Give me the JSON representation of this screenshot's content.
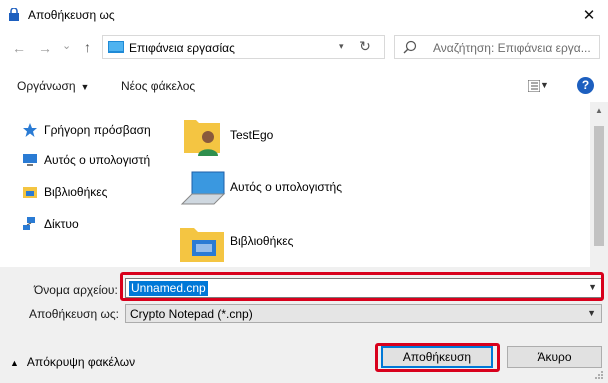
{
  "window": {
    "title": "Αποθήκευση ως",
    "close_glyph": "✕"
  },
  "nav": {
    "back_glyph": "←",
    "forward_glyph": "→",
    "recent_glyph": "⌄",
    "up_glyph": "↑",
    "address_path": "Επιφάνεια εργασίας",
    "refresh_glyph": "↻",
    "search_placeholder": "Αναζήτηση: Επιφάνεια εργα..."
  },
  "toolbar": {
    "organize_label": "Οργάνωση",
    "new_folder_label": "Νέος φάκελος",
    "help_glyph": "?"
  },
  "sidebar": {
    "items": [
      {
        "label": "Γρήγορη πρόσβαση",
        "icon": "star-icon"
      },
      {
        "label": "Αυτός ο υπολογιστή",
        "icon": "computer-icon"
      },
      {
        "label": "Βιβλιοθήκες",
        "icon": "library-icon"
      },
      {
        "label": "Δίκτυο",
        "icon": "network-icon"
      }
    ]
  },
  "content": {
    "items": [
      {
        "label": "TestEgo",
        "icon": "user-folder-icon"
      },
      {
        "label": "Αυτός ο υπολογιστής",
        "icon": "computer-icon"
      },
      {
        "label": "Βιβλιοθήκες",
        "icon": "library-folder-icon"
      }
    ]
  },
  "form": {
    "filename_label": "Όνομα αρχείου:",
    "filename_value": "Unnamed.cnp",
    "filetype_label": "Αποθήκευση ως:",
    "filetype_value": "Crypto Notepad (*.cnp)"
  },
  "footer": {
    "hide_folders_label": "Απόκρυψη φακέλων",
    "save_label": "Αποθήκευση",
    "cancel_label": "Άκυρο"
  },
  "colors": {
    "accent": "#0078d7",
    "highlight_box": "#d8001c",
    "folder": "#f4c542"
  }
}
